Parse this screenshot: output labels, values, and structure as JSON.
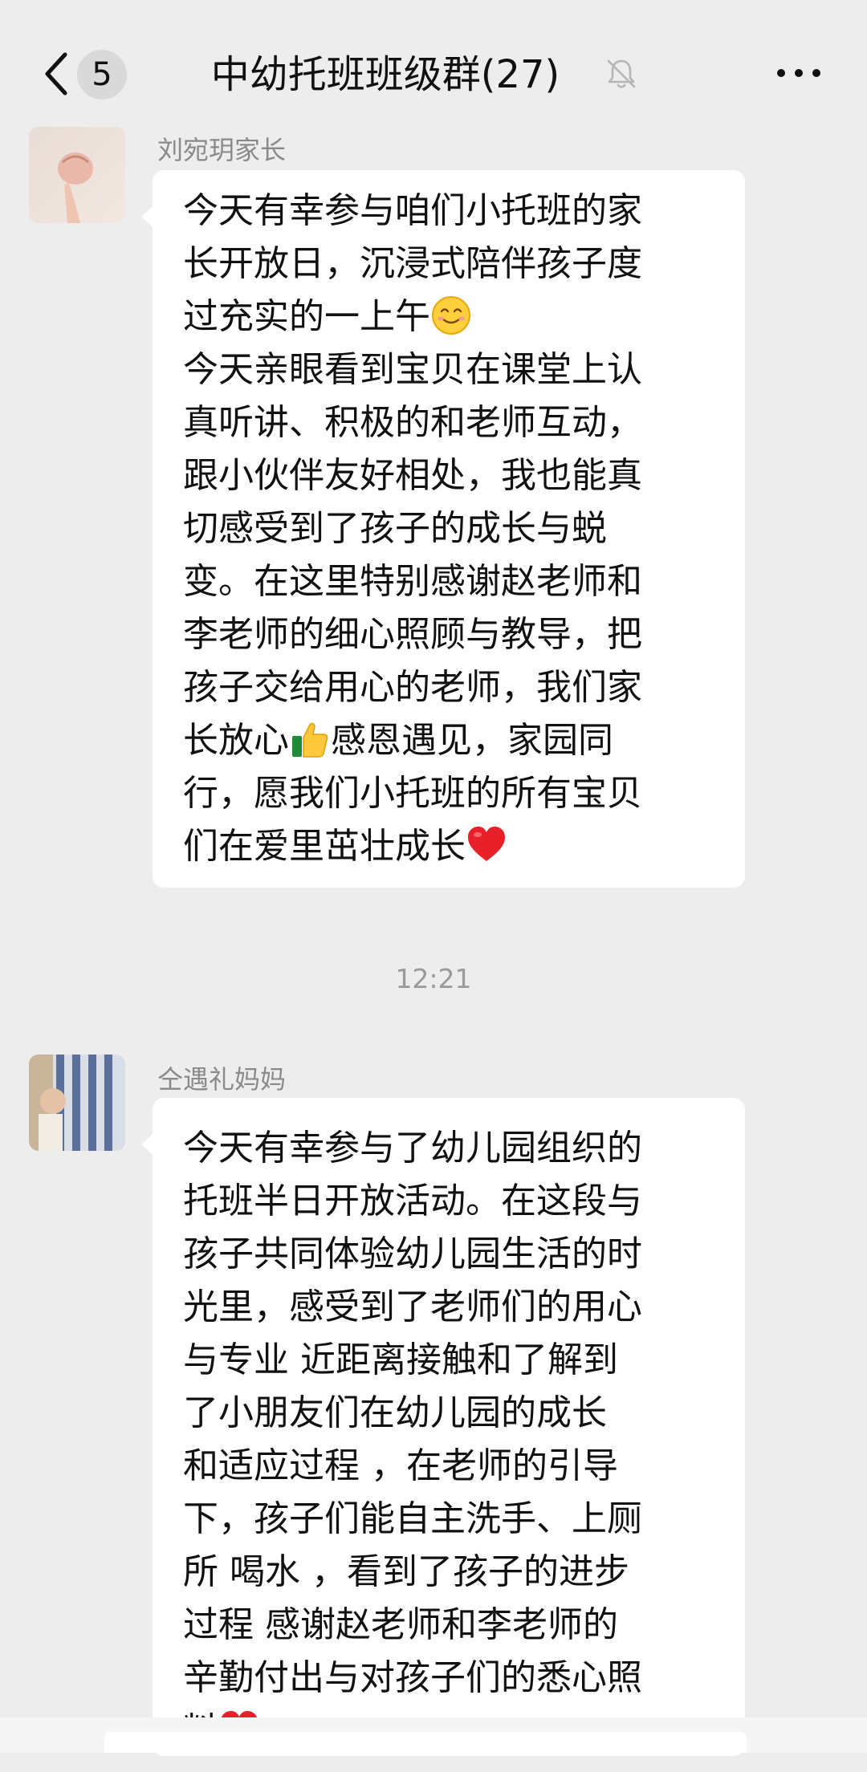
{
  "header": {
    "unread_count": "5",
    "title": "中幼托班班级群(27)"
  },
  "messages": [
    {
      "sender": "刘宛玥家长",
      "lines": [
        "今天有幸参与咱们小托班的家",
        "长开放日，沉浸式陪伴孩子度",
        "过充实的一上午",
        "今天亲眼看到宝贝在课堂上认",
        "真听讲、积极的和老师互动，",
        "跟小伙伴友好相处，我也能真",
        "切感受到了孩子的成长与蜕",
        "变。在这里特别感谢赵老师和",
        "李老师的细心照顾与教导，把",
        "孩子交给用心的老师，我们家",
        "长放心",
        "感恩遇见，家园同",
        "行，愿我们小托班的所有宝贝",
        "们在爱里茁壮成长"
      ]
    },
    {
      "sender": "仝遇礼妈妈",
      "lines": [
        "今天有幸参与了幼儿园组织的",
        "托班半日开放活动。在这段与",
        "孩子共同体验幼儿园生活的时",
        "光里，感受到了老师们的用心",
        "与专业 近距离接触和了解到",
        "了小朋友们在幼儿园的成长",
        "和适应过程 ，在老师的引导",
        "下，孩子们能自主洗手、上厕",
        "所 喝水 ，看到了孩子的进步",
        "过程 感谢赵老师和李老师的",
        "辛勤付出与对孩子们的悉心照",
        "料"
      ]
    }
  ],
  "timestamp": "12:21",
  "icons": {
    "back": "chevron-left-icon",
    "mute": "bell-muted-icon",
    "more": "more-dots-icon",
    "smile": "smiling-face-emoji",
    "thumbs": "thumbs-up-emoji",
    "heart": "red-heart-emoji"
  },
  "colors": {
    "background": "#ededed",
    "bubble": "#ffffff",
    "secondary_text": "#8a8a8a"
  }
}
